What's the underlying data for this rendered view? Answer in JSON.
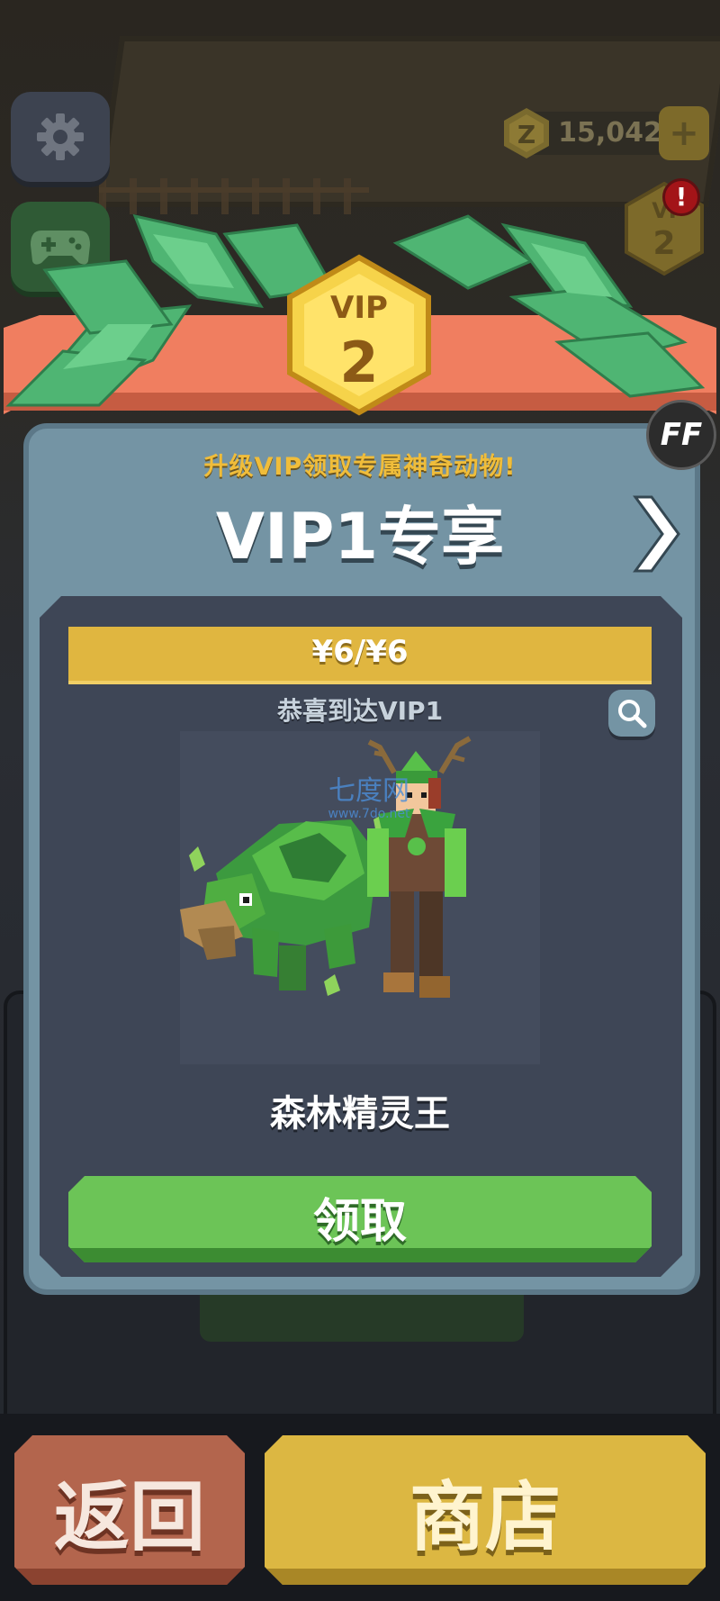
{
  "hud": {
    "settings_icon": "gear-icon",
    "gamepad_icon": "gamepad-icon",
    "coins": "15,042",
    "coin_icon": "z-coin-icon",
    "plus_label": "+",
    "mini_vip_level": "2",
    "mini_vip_prefix": "VI",
    "alert_mark": "!"
  },
  "modal": {
    "badge_label": "VIP",
    "badge_level": "2",
    "subtitle": "升级VIP领取专属神奇动物!",
    "title": "VIP1专享",
    "ff_label": "FF",
    "progress_text": "¥6/¥6",
    "progress_fraction": 1.0,
    "reached_text": "恭喜到达VIP1",
    "watermark_cn": "七度网",
    "watermark_url": "www.7do.net",
    "reward_name": "森林精灵王",
    "claim_label": "领取"
  },
  "footer": {
    "back_label": "返回",
    "shop_label": "商店"
  },
  "colors": {
    "accent_gold": "#e0b640",
    "claim_green": "#6cc457",
    "back_red": "#b3654d",
    "shop_yellow": "#dcb742",
    "modal_blue": "#7494a4"
  }
}
